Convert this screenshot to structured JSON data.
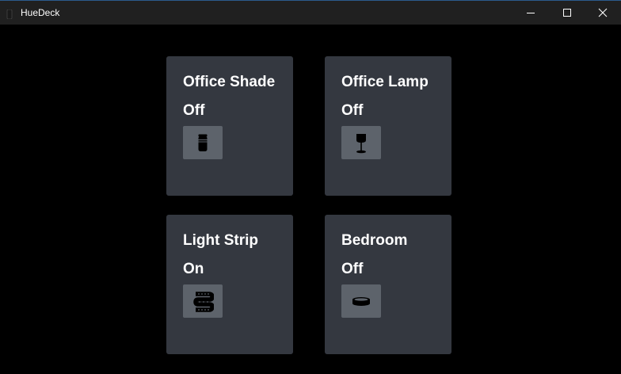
{
  "window": {
    "title": "HueDeck",
    "icon": "lamp-app-icon",
    "controls": [
      "minimize-icon",
      "maximize-icon",
      "close-icon"
    ]
  },
  "tiles": [
    {
      "name": "Office Shade",
      "state": "Off",
      "icon": "cylinder-lamp-icon"
    },
    {
      "name": "Office Lamp",
      "state": "Off",
      "icon": "table-lamp-icon"
    },
    {
      "name": "Light Strip",
      "state": "On",
      "icon": "light-strip-icon"
    },
    {
      "name": "Bedroom",
      "state": "Off",
      "icon": "ceiling-light-icon"
    }
  ],
  "colors": {
    "titlebar": "#202020",
    "background": "#000000",
    "tile": "#343840",
    "icon_button": "#5d636b"
  }
}
